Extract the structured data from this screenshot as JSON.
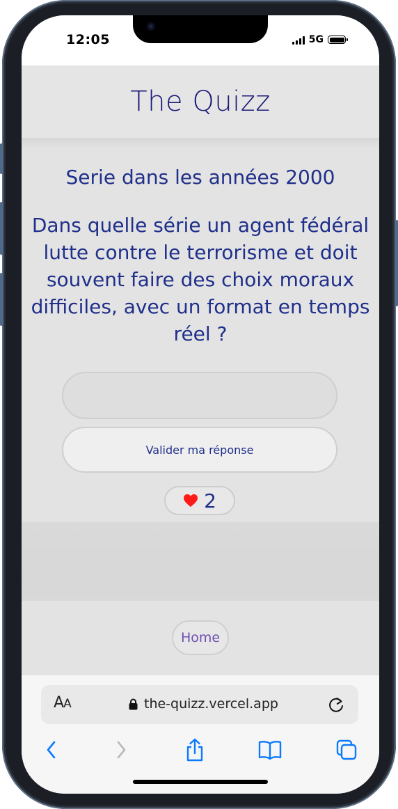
{
  "status_bar": {
    "time": "12:05",
    "network": "5G"
  },
  "header": {
    "title": "The Quizz"
  },
  "quiz": {
    "category": "Serie dans les années 2000",
    "question": "Dans quelle série un agent fédéral lutte contre le terrorisme et doit souvent faire des choix moraux difficiles, avec un format en temps réel ?",
    "answer_value": "",
    "submit_label": "Valider ma réponse",
    "lives": "2"
  },
  "footer": {
    "home_label": "Home"
  },
  "browser": {
    "reader_label_big": "A",
    "reader_label_small": "A",
    "url": "the-quizz.vercel.app"
  },
  "colors": {
    "title": "#1a1a78",
    "text": "#1f2f8a",
    "home": "#6d4fb0",
    "heart": "#ff1a1a",
    "safari_blue": "#0a7aff"
  }
}
